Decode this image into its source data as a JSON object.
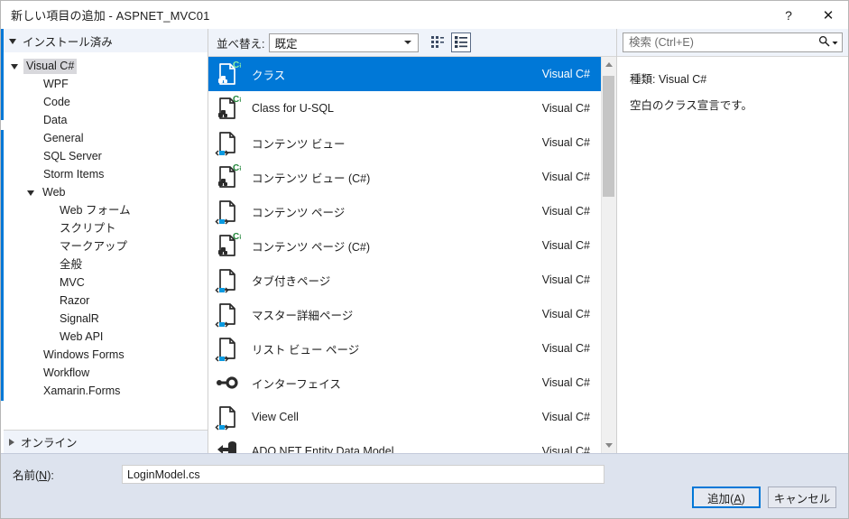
{
  "window": {
    "title": "新しい項目の追加 - ASPNET_MVC01",
    "help_label": "?",
    "close_label": "✕"
  },
  "sidebar": {
    "installed_header": "インストール済み",
    "online_header": "オンライン",
    "tree": [
      {
        "label": "Visual C#",
        "indent": 0,
        "expander": "down",
        "selected": true
      },
      {
        "label": "WPF",
        "indent": 1,
        "expander": "none",
        "selected": false
      },
      {
        "label": "Code",
        "indent": 1,
        "expander": "none",
        "selected": false
      },
      {
        "label": "Data",
        "indent": 1,
        "expander": "none",
        "selected": false
      },
      {
        "label": "General",
        "indent": 1,
        "expander": "none",
        "selected": false
      },
      {
        "label": "SQL Server",
        "indent": 1,
        "expander": "none",
        "selected": false
      },
      {
        "label": "Storm Items",
        "indent": 1,
        "expander": "none",
        "selected": false
      },
      {
        "label": "Web",
        "indent": 1,
        "expander": "down",
        "selected": false
      },
      {
        "label": "Web フォーム",
        "indent": 2,
        "expander": "none",
        "selected": false
      },
      {
        "label": "スクリプト",
        "indent": 2,
        "expander": "none",
        "selected": false
      },
      {
        "label": "マークアップ",
        "indent": 2,
        "expander": "none",
        "selected": false
      },
      {
        "label": "全般",
        "indent": 2,
        "expander": "none",
        "selected": false
      },
      {
        "label": "MVC",
        "indent": 2,
        "expander": "none",
        "selected": false
      },
      {
        "label": "Razor",
        "indent": 2,
        "expander": "none",
        "selected": false
      },
      {
        "label": "SignalR",
        "indent": 2,
        "expander": "none",
        "selected": false
      },
      {
        "label": "Web API",
        "indent": 2,
        "expander": "none",
        "selected": false
      },
      {
        "label": "Windows Forms",
        "indent": 1,
        "expander": "none",
        "selected": false
      },
      {
        "label": "Workflow",
        "indent": 1,
        "expander": "none",
        "selected": false
      },
      {
        "label": "Xamarin.Forms",
        "indent": 1,
        "expander": "none",
        "selected": false
      }
    ]
  },
  "toolbar": {
    "sort_label": "並べ替え:",
    "sort_value": "既定",
    "view_tiles_icon": "tiles-view-icon",
    "view_list_icon": "list-view-icon",
    "active_view": "list"
  },
  "list": {
    "scrollbar": {
      "thumb_top_pct": 1,
      "thumb_height_pct": 33
    },
    "items": [
      {
        "name": "クラス",
        "lang": "Visual C#",
        "icon": "csharp-class-icon",
        "selected": true
      },
      {
        "name": "Class for U-SQL",
        "lang": "Visual C#",
        "icon": "csharp-class-icon",
        "selected": false
      },
      {
        "name": "コンテンツ ビュー",
        "lang": "Visual C#",
        "icon": "xaml-page-icon",
        "selected": false
      },
      {
        "name": "コンテンツ ビュー (C#)",
        "lang": "Visual C#",
        "icon": "csharp-class-icon",
        "selected": false
      },
      {
        "name": "コンテンツ ページ",
        "lang": "Visual C#",
        "icon": "xaml-page-icon",
        "selected": false
      },
      {
        "name": "コンテンツ ページ (C#)",
        "lang": "Visual C#",
        "icon": "csharp-class-icon",
        "selected": false
      },
      {
        "name": "タブ付きページ",
        "lang": "Visual C#",
        "icon": "xaml-page-icon",
        "selected": false
      },
      {
        "name": "マスター詳細ページ",
        "lang": "Visual C#",
        "icon": "xaml-page-icon",
        "selected": false
      },
      {
        "name": "リスト ビュー ページ",
        "lang": "Visual C#",
        "icon": "xaml-page-icon",
        "selected": false
      },
      {
        "name": "インターフェイス",
        "lang": "Visual C#",
        "icon": "interface-icon",
        "selected": false
      },
      {
        "name": "View Cell",
        "lang": "Visual C#",
        "icon": "xaml-page-icon",
        "selected": false
      },
      {
        "name": "ADO.NET Entity Data Model",
        "lang": "Visual C#",
        "icon": "ado-entity-icon",
        "selected": false
      }
    ]
  },
  "search": {
    "placeholder": "検索 (Ctrl+E)",
    "value": "",
    "icon": "search-icon",
    "dropdown_icon": "chevron-down-icon"
  },
  "details": {
    "kind_line": "種類:  Visual C#",
    "description": "空白のクラス宣言です。"
  },
  "footer": {
    "name_label_pre": "名前(",
    "name_label_key": "N",
    "name_label_post": "):",
    "name_value": "LoginModel.cs",
    "name_placeholder": "",
    "add_label_pre": "追加(",
    "add_label_key": "A",
    "add_label_post": ")",
    "cancel_label": "キャンセル"
  },
  "colors": {
    "accent": "#0078d7",
    "header_bg": "#eff3fa",
    "footer_bg": "#dde3ee",
    "csharp_green": "#22863a"
  }
}
